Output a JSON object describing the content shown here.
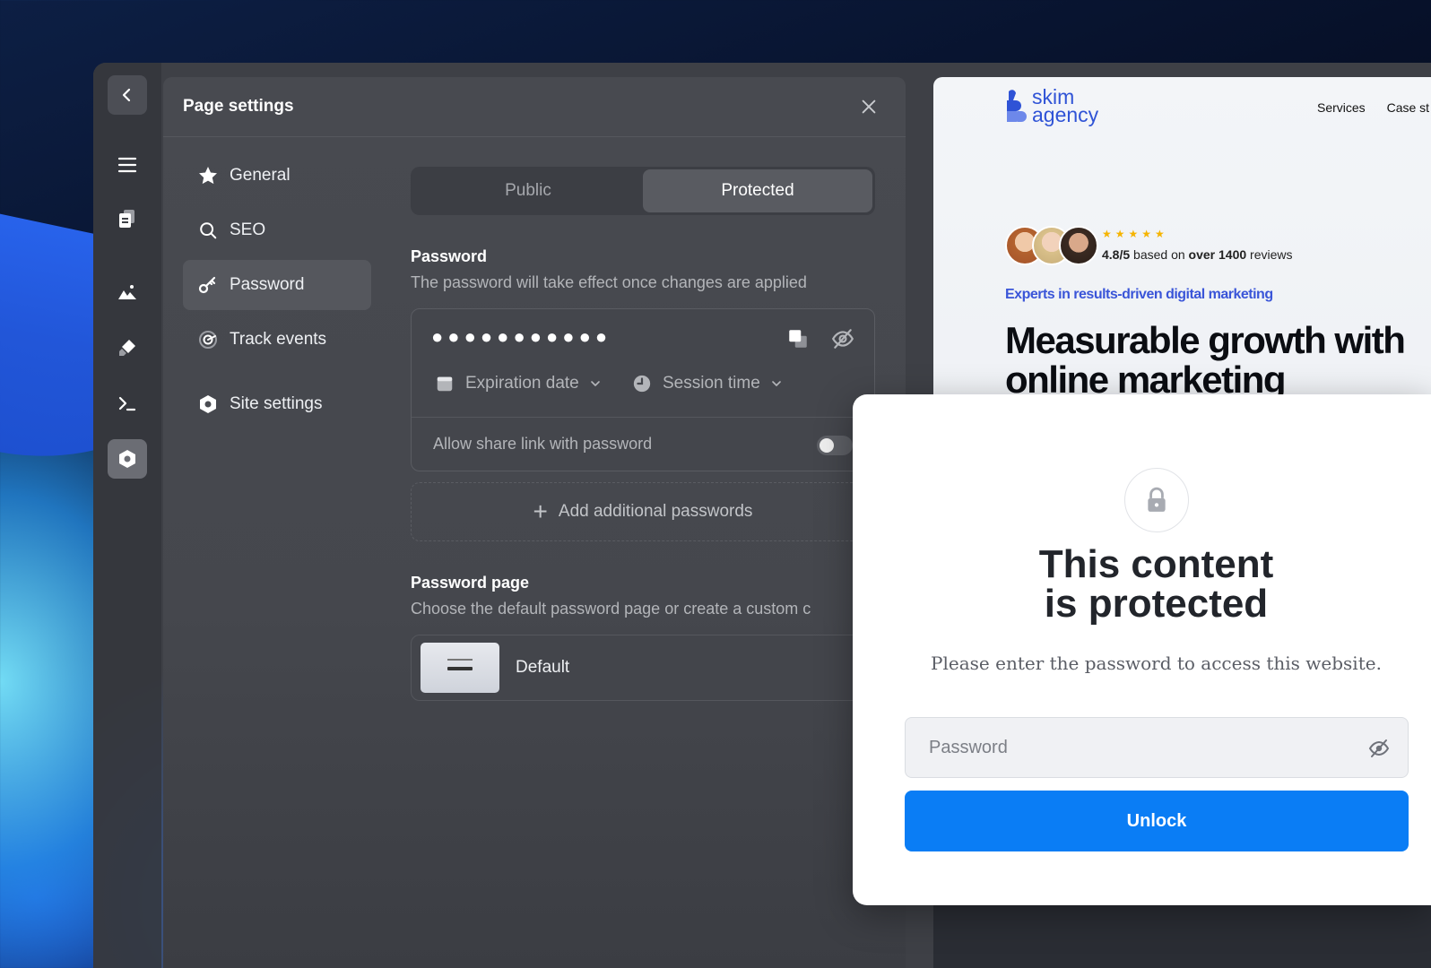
{
  "panel": {
    "title": "Page settings",
    "nav": [
      {
        "label": "General",
        "icon": "star-icon"
      },
      {
        "label": "SEO",
        "icon": "search-icon"
      },
      {
        "label": "Password",
        "icon": "key-icon"
      },
      {
        "label": "Track events",
        "icon": "track-icon"
      },
      {
        "label": "Site settings",
        "icon": "hexagon-icon"
      }
    ],
    "active_nav": "Password"
  },
  "visibility": {
    "options": [
      "Public",
      "Protected"
    ],
    "selected": "Protected"
  },
  "password_section": {
    "label": "Password",
    "description": "The password will take effect once changes are applied",
    "masked_value": "●●●●●●●●●●●",
    "expiration_label": "Expiration date",
    "session_label": "Session time",
    "share_label": "Allow share link with password",
    "share_enabled": false,
    "add_label": "Add additional passwords"
  },
  "password_page": {
    "label": "Password page",
    "description": "Choose the default password page or create a custom c",
    "default_label": "Default"
  },
  "preview": {
    "logo_line1": "skim",
    "logo_line2": "agency",
    "nav_links": [
      "Services",
      "Case st"
    ],
    "stars": "★★★★★",
    "rating_score": "4.8/5",
    "rating_mid": " based on ",
    "rating_count": "over 1400",
    "rating_end": " reviews",
    "tagline": "Experts in results-driven digital marketing",
    "headline": "Measurable growth with online marketing"
  },
  "modal": {
    "title_line1": "This content",
    "title_line2": "is protected",
    "subtitle": "Please enter the password to access this website.",
    "input_placeholder": "Password",
    "button_label": "Unlock"
  },
  "colors": {
    "accent_blue": "#0a7df5",
    "brand_blue": "#2f53d6",
    "star_gold": "#f5b400"
  }
}
